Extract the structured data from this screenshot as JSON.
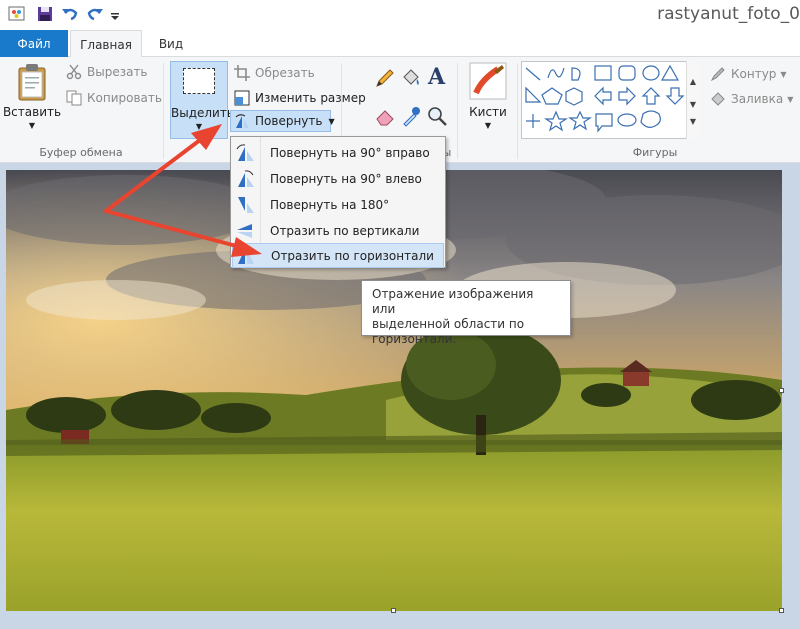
{
  "window": {
    "title": "rastyanut_foto_0"
  },
  "tabs": {
    "file": "Файл",
    "home": "Главная",
    "view": "Вид"
  },
  "clipboard": {
    "paste": "Вставить",
    "cut": "Вырезать",
    "copy": "Копировать",
    "group": "Буфер обмена"
  },
  "image": {
    "select": "Выделить",
    "crop": "Обрезать",
    "resize": "Изменить размер",
    "rotate": "Повернуть",
    "group_visible": "И",
    "group_tail": "ы"
  },
  "brushes": {
    "label": "Кисти"
  },
  "shapes": {
    "outline": "Контур",
    "fill": "Заливка",
    "group": "Фигуры"
  },
  "rotate_menu": {
    "items": [
      {
        "label": "Повернуть на 90° вправо"
      },
      {
        "label": "Повернуть на 90° влево"
      },
      {
        "label": "Повернуть на 180°"
      },
      {
        "label": "Отразить по вертикали"
      },
      {
        "label": "Отразить по горизонтали"
      }
    ],
    "highlighted_index": 4
  },
  "tooltip": {
    "lines": [
      "Отражение изображения или",
      "выделенной области по",
      "горизонтали."
    ]
  },
  "colors": {
    "file_tab": "#1979ca",
    "selection": "#c7dff7",
    "arrow": "#e8442f"
  }
}
